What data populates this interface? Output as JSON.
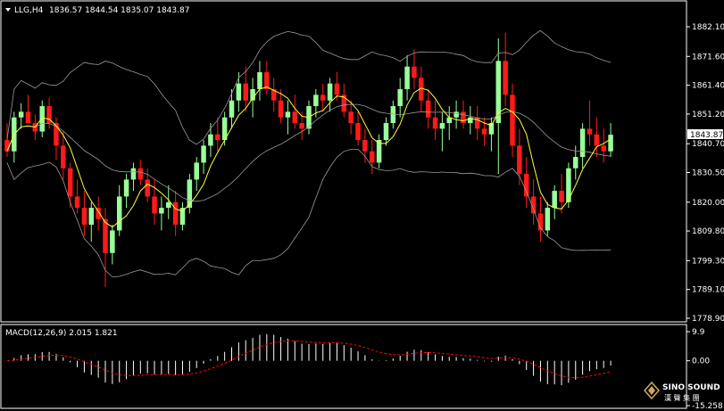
{
  "header": {
    "symbol_timeframe": "LLG,H4",
    "ohlc": "1836.57 1844.54 1835.07 1843.87"
  },
  "price_panel": {
    "y_ticks": [
      "1882.10",
      "1871.60",
      "1861.40",
      "1851.20",
      "1840.70",
      "1830.50",
      "1820.00",
      "1809.80",
      "1799.30",
      "1789.10",
      "1778.90"
    ],
    "current_price": "1843.87"
  },
  "macd_panel": {
    "label": "MACD(12,26,9) 2.015 1.821",
    "y_ticks": [
      "9.9",
      "0.00",
      "-15.258"
    ]
  },
  "watermark": {
    "brand": "SINO SOUND",
    "sub": "漢 聲 集 團"
  },
  "colors": {
    "background": "#000000",
    "axis": "#ffffff",
    "grid": "#404040",
    "bull": "#99ff99",
    "bear": "#ff1a1a",
    "ma": "#ffff33",
    "bands": "#9a9a9a",
    "macd_hist": "#ffffff",
    "macd_signal": "#ff0000"
  },
  "chart_data": {
    "type": "candlestick",
    "title": "LLG,H4",
    "ylim": [
      1778.9,
      1882.1
    ],
    "candles": [
      [
        1842,
        1848,
        1836,
        1838
      ],
      [
        1838,
        1852,
        1834,
        1850
      ],
      [
        1850,
        1855,
        1846,
        1852
      ],
      [
        1852,
        1858,
        1848,
        1848
      ],
      [
        1848,
        1851,
        1842,
        1845
      ],
      [
        1845,
        1856,
        1843,
        1854
      ],
      [
        1854,
        1857,
        1846,
        1848
      ],
      [
        1848,
        1850,
        1835,
        1840
      ],
      [
        1840,
        1845,
        1828,
        1832
      ],
      [
        1832,
        1834,
        1818,
        1822
      ],
      [
        1822,
        1828,
        1816,
        1818
      ],
      [
        1818,
        1824,
        1808,
        1812
      ],
      [
        1812,
        1820,
        1806,
        1818
      ],
      [
        1818,
        1822,
        1810,
        1814
      ],
      [
        1814,
        1818,
        1790,
        1802
      ],
      [
        1802,
        1812,
        1798,
        1810
      ],
      [
        1810,
        1826,
        1808,
        1822
      ],
      [
        1822,
        1830,
        1818,
        1828
      ],
      [
        1828,
        1834,
        1824,
        1832
      ],
      [
        1832,
        1835,
        1826,
        1828
      ],
      [
        1828,
        1832,
        1820,
        1822
      ],
      [
        1822,
        1828,
        1812,
        1816
      ],
      [
        1816,
        1822,
        1810,
        1818
      ],
      [
        1818,
        1826,
        1814,
        1820
      ],
      [
        1820,
        1824,
        1808,
        1812
      ],
      [
        1812,
        1820,
        1810,
        1818
      ],
      [
        1818,
        1830,
        1816,
        1828
      ],
      [
        1828,
        1836,
        1824,
        1834
      ],
      [
        1834,
        1842,
        1830,
        1840
      ],
      [
        1840,
        1848,
        1836,
        1844
      ],
      [
        1844,
        1850,
        1838,
        1842
      ],
      [
        1842,
        1852,
        1840,
        1850
      ],
      [
        1850,
        1860,
        1846,
        1856
      ],
      [
        1856,
        1866,
        1852,
        1862
      ],
      [
        1862,
        1868,
        1852,
        1856
      ],
      [
        1856,
        1864,
        1850,
        1860
      ],
      [
        1860,
        1870,
        1856,
        1866
      ],
      [
        1866,
        1870,
        1858,
        1860
      ],
      [
        1860,
        1864,
        1852,
        1856
      ],
      [
        1856,
        1860,
        1848,
        1850
      ],
      [
        1850,
        1856,
        1844,
        1852
      ],
      [
        1852,
        1858,
        1846,
        1848
      ],
      [
        1848,
        1852,
        1842,
        1846
      ],
      [
        1846,
        1856,
        1844,
        1854
      ],
      [
        1854,
        1860,
        1850,
        1858
      ],
      [
        1858,
        1862,
        1852,
        1856
      ],
      [
        1856,
        1864,
        1852,
        1862
      ],
      [
        1862,
        1866,
        1856,
        1858
      ],
      [
        1858,
        1862,
        1850,
        1852
      ],
      [
        1852,
        1856,
        1844,
        1848
      ],
      [
        1848,
        1852,
        1840,
        1842
      ],
      [
        1842,
        1846,
        1834,
        1838
      ],
      [
        1838,
        1842,
        1830,
        1834
      ],
      [
        1834,
        1844,
        1832,
        1842
      ],
      [
        1842,
        1850,
        1840,
        1848
      ],
      [
        1848,
        1856,
        1846,
        1854
      ],
      [
        1854,
        1864,
        1850,
        1860
      ],
      [
        1860,
        1872,
        1856,
        1868
      ],
      [
        1868,
        1874,
        1860,
        1864
      ],
      [
        1864,
        1868,
        1852,
        1856
      ],
      [
        1856,
        1860,
        1846,
        1850
      ],
      [
        1850,
        1856,
        1842,
        1846
      ],
      [
        1846,
        1852,
        1838,
        1848
      ],
      [
        1848,
        1854,
        1842,
        1850
      ],
      [
        1850,
        1856,
        1846,
        1852
      ],
      [
        1852,
        1856,
        1846,
        1848
      ],
      [
        1848,
        1854,
        1844,
        1850
      ],
      [
        1850,
        1854,
        1842,
        1846
      ],
      [
        1846,
        1850,
        1840,
        1844
      ],
      [
        1844,
        1850,
        1838,
        1848
      ],
      [
        1848,
        1878,
        1830,
        1870
      ],
      [
        1870,
        1880,
        1854,
        1858
      ],
      [
        1858,
        1862,
        1836,
        1840
      ],
      [
        1840,
        1846,
        1826,
        1830
      ],
      [
        1830,
        1836,
        1818,
        1822
      ],
      [
        1822,
        1828,
        1812,
        1816
      ],
      [
        1816,
        1822,
        1806,
        1810
      ],
      [
        1810,
        1820,
        1808,
        1818
      ],
      [
        1818,
        1826,
        1814,
        1824
      ],
      [
        1824,
        1830,
        1816,
        1820
      ],
      [
        1820,
        1834,
        1818,
        1832
      ],
      [
        1832,
        1840,
        1828,
        1836
      ],
      [
        1836,
        1848,
        1832,
        1846
      ],
      [
        1846,
        1856,
        1840,
        1844
      ],
      [
        1844,
        1850,
        1836,
        1840
      ],
      [
        1840,
        1846,
        1834,
        1838
      ],
      [
        1838,
        1848,
        1836,
        1843.87
      ]
    ],
    "macd": {
      "period": "12,26,9",
      "main": 2.015,
      "signal": 1.821,
      "ylim": [
        -15.258,
        9.9
      ]
    }
  }
}
